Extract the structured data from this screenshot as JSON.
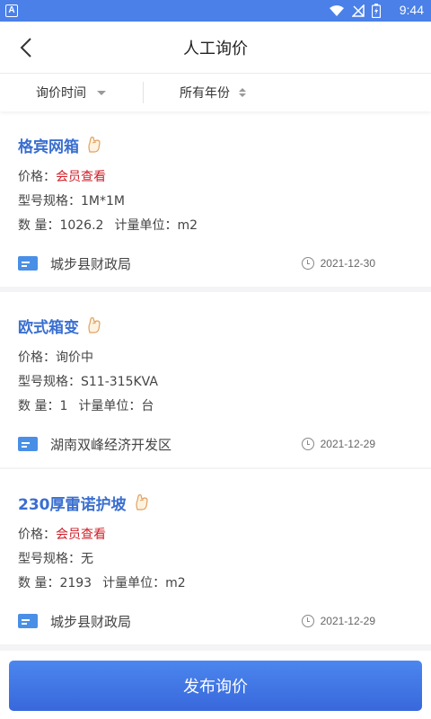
{
  "status_bar": {
    "app_badge": "A",
    "time": "9:44",
    "icons": [
      "wifi-icon",
      "signal-icon",
      "battery-icon"
    ]
  },
  "header": {
    "title": "人工询价",
    "back_icon": "chevron-left-icon"
  },
  "filters": [
    {
      "label": "询价时间",
      "icon": "caret-down-icon"
    },
    {
      "label": "所有年份",
      "icon": "sort-icon"
    }
  ],
  "labels": {
    "price": "价格：",
    "spec": "型号规格：",
    "quantity": "数 量：",
    "unit": "计量单位："
  },
  "items": [
    {
      "name": "格宾网箱",
      "price": "会员查看",
      "spec": "1M*1M",
      "quantity": "1026.2",
      "unit": "m2",
      "org": "城步县财政局",
      "date": "2021-12-30"
    },
    {
      "name": "欧式箱变",
      "price": "询价中",
      "spec": "S11-315KVA",
      "quantity": "1",
      "unit": "台",
      "org": "湖南双峰经济开发区",
      "date": "2021-12-29"
    },
    {
      "name": "230厚雷诺护坡",
      "price": "会员查看",
      "spec": "无",
      "quantity": "2193",
      "unit": "m2",
      "org": "城步县财政局",
      "date": "2021-12-29"
    }
  ],
  "publish_button": "发布询价",
  "colors": {
    "primary": "#4a80e8",
    "item_title": "#3a6fd0",
    "price_red": "#d0202a",
    "org_icon": "#4a8fe6"
  }
}
